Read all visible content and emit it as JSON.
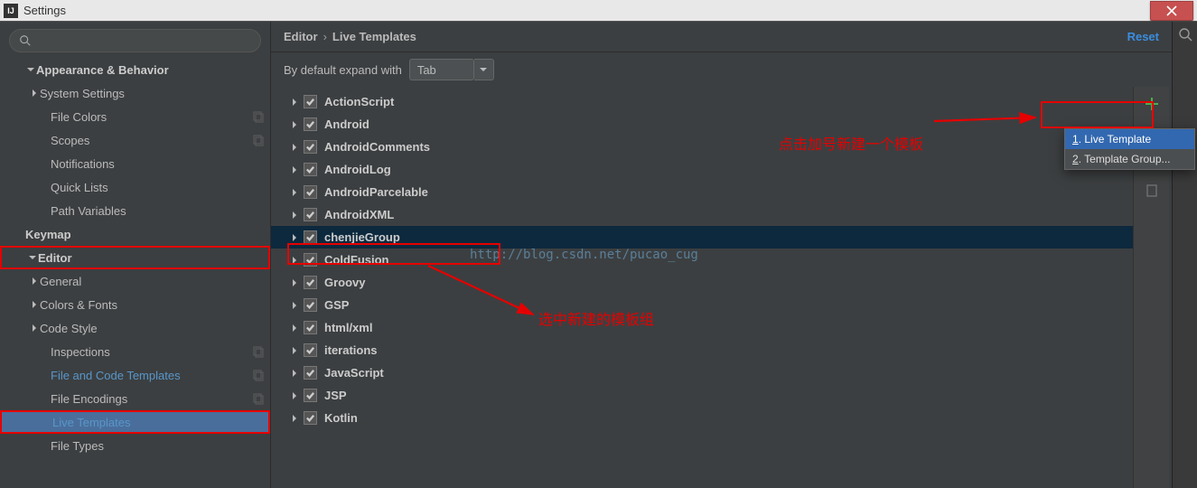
{
  "titlebar": {
    "title": "Settings"
  },
  "sidebar": {
    "rows": [
      {
        "id": "appearance",
        "label": "Appearance & Behavior",
        "pad": "pad-0",
        "bold": true,
        "expanded": true,
        "hasArrow": true
      },
      {
        "id": "system-settings",
        "label": "System Settings",
        "pad": "pad-1a",
        "bold": false,
        "hasArrow": true,
        "arrowRight": true
      },
      {
        "id": "file-colors",
        "label": "File Colors",
        "pad": "pad-2",
        "hasCopy": true
      },
      {
        "id": "scopes",
        "label": "Scopes",
        "pad": "pad-2",
        "hasCopy": true
      },
      {
        "id": "notifications",
        "label": "Notifications",
        "pad": "pad-2"
      },
      {
        "id": "quick-lists",
        "label": "Quick Lists",
        "pad": "pad-2"
      },
      {
        "id": "path-variables",
        "label": "Path Variables",
        "pad": "pad-2"
      },
      {
        "id": "keymap",
        "label": "Keymap",
        "pad": "pad-0",
        "bold": true
      },
      {
        "id": "editor",
        "label": "Editor",
        "pad": "pad-0",
        "bold": true,
        "expanded": true,
        "hasArrow": true,
        "arrowDown": true,
        "redBox": true
      },
      {
        "id": "general",
        "label": "General",
        "pad": "pad-1a",
        "hasArrow": true,
        "arrowRight": true
      },
      {
        "id": "colors-fonts",
        "label": "Colors & Fonts",
        "pad": "pad-1a",
        "hasArrow": true,
        "arrowRight": true
      },
      {
        "id": "code-style",
        "label": "Code Style",
        "pad": "pad-1a",
        "hasArrow": true,
        "arrowRight": true
      },
      {
        "id": "inspections",
        "label": "Inspections",
        "pad": "pad-2",
        "hasCopy": true
      },
      {
        "id": "file-code-templates",
        "label": "File and Code Templates",
        "pad": "pad-2",
        "link": true,
        "hasCopy": true
      },
      {
        "id": "file-encodings",
        "label": "File Encodings",
        "pad": "pad-2",
        "hasCopy": true
      },
      {
        "id": "live-templates",
        "label": "Live Templates",
        "pad": "pad-2",
        "link": true,
        "selected": true,
        "redBox": true
      },
      {
        "id": "file-types",
        "label": "File Types",
        "pad": "pad-2"
      }
    ]
  },
  "breadcrumb": {
    "a": "Editor",
    "b": "Live Templates",
    "reset": "Reset",
    "sep": "›"
  },
  "expand": {
    "lbl": "By default expand with",
    "value": "Tab"
  },
  "templates": [
    {
      "name": "ActionScript",
      "checked": true
    },
    {
      "name": "Android",
      "checked": true
    },
    {
      "name": "AndroidComments",
      "checked": true
    },
    {
      "name": "AndroidLog",
      "checked": true
    },
    {
      "name": "AndroidParcelable",
      "checked": true
    },
    {
      "name": "AndroidXML",
      "checked": true
    },
    {
      "name": "chenjieGroup",
      "checked": true,
      "selected": true
    },
    {
      "name": "ColdFusion",
      "checked": true
    },
    {
      "name": "Groovy",
      "checked": true
    },
    {
      "name": "GSP",
      "checked": true
    },
    {
      "name": "html/xml",
      "checked": true
    },
    {
      "name": "iterations",
      "checked": true
    },
    {
      "name": "JavaScript",
      "checked": true
    },
    {
      "name": "JSP",
      "checked": true
    },
    {
      "name": "Kotlin",
      "checked": true
    }
  ],
  "popup": {
    "items": [
      {
        "prefix": "1",
        "label": ". Live Template",
        "hi": true
      },
      {
        "prefix": "2",
        "label": ". Template Group..."
      }
    ]
  },
  "annotations": {
    "plus": "点击加号新建一个模板",
    "select": "选中新建的模板组"
  },
  "watermark": "http://blog.csdn.net/pucao_cug"
}
